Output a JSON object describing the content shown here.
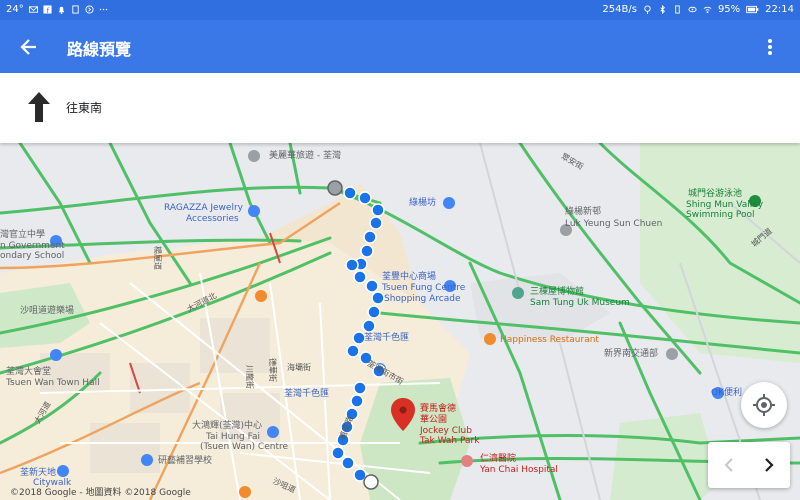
{
  "status_bar": {
    "temperature": "24°",
    "speed": "254B/s",
    "battery": "95%",
    "time": "22:14",
    "left_icons": [
      "mail-icon",
      "facebook-icon",
      "bell-icon",
      "sim-icon",
      "chevron-circle-icon",
      "more-dots-icon"
    ],
    "right_icons": [
      "location-icon",
      "bluetooth-icon",
      "vibrate-icon",
      "eye-icon",
      "wifi-icon",
      "battery-icon"
    ]
  },
  "appbar": {
    "title": "路線預覽",
    "back_icon": "arrow-back-icon",
    "menu_icon": "more-vert-icon",
    "color": "#3b78e7"
  },
  "direction": {
    "icon": "arrow-up-icon",
    "text": "往東南"
  },
  "map": {
    "labels": {
      "meilihua": "美麗華旅遊 - 荃灣",
      "ragazza1": "RAGAZZA Jewelry",
      "ragazza2": "Accessories",
      "luyang_fang": "綠楊坊",
      "luyang_new": "綠楊新邨",
      "luyang_new_en": "Luk Yeung Sun Chuen",
      "city_gate_pool": "城門谷游泳池",
      "shing_mun1": "Shing Mun Valley",
      "shing_mun2": "Swimming Pool",
      "gov_school1": "灣官立中學",
      "gov_school2": "n Government",
      "gov_school3": "ondary School",
      "tsuen_fung_zh": "荃豐中心商場",
      "tsuen_fung_en1": "Tsuen Fung Centre",
      "tsuen_fung_en2": "Shopping Arcade",
      "sam_tung_uk_zh": "三棟屋博物館",
      "sam_tung_uk_en": "Sam Tung Uk Museum",
      "sha_tsui_playground": "沙咀道遊樂場",
      "happiness": "Happiness Restaurant",
      "mtr_interchange": "新界南交通部",
      "town_hall_zh": "荃灣大會堂",
      "town_hall_en": "Tsuen Wan Town Hall",
      "tsuen_wan_chin_sik": "荃灣千色匯",
      "tsuen_wan_chin_sik2": "荃灣千色匯",
      "jockey_zh1": "賽馬會德",
      "jockey_zh2": "華公園",
      "jockey_en1": "Jockey Club",
      "jockey_en2": "Tak Wah Park",
      "ok_store": "OK便利",
      "tai_hung_fai_zh": "大鴻輝(荃灣)中心",
      "tai_hung_fai_en1": "Tai Hung Fai",
      "tai_hung_fai_en2": "(Tsuen Wan) Centre",
      "yan_chai_zh": "仁濟醫院",
      "yan_chai_en": "Yan Chai Hospital",
      "research_school": "研藝補習學校",
      "citywalk_zh": "荃新天地",
      "citywalk_en": "Citywalk",
      "road_tai_ho": "大河道北",
      "road_tai_ho2": "大河道",
      "road_sha_tsui": "沙咀道",
      "road_hoi_pa": "海壩街",
      "road_chuen_lung": "川龍街",
      "road_tak_wah": "德華街",
      "road_yeung_uk": "楊屋道",
      "road_tsuen_wan_market": "荃灣街市街",
      "road_tai_o": "蕙荃路",
      "road_sheung_kok": "城門道",
      "road_kwan_mun": "眾安街"
    },
    "copyright": "©2018 Google - 地圖資料 ©2018 Google",
    "route_color": "#1a73e8",
    "icons": [
      "shopping-bag-icon",
      "museum-icon",
      "restaurant-icon",
      "school-icon",
      "park-icon",
      "hospital-icon",
      "building-icon",
      "location-pin-icon"
    ]
  },
  "controls": {
    "my_location_icon": "my-location-icon",
    "prev_icon": "chevron-left-icon",
    "next_icon": "chevron-right-icon"
  }
}
